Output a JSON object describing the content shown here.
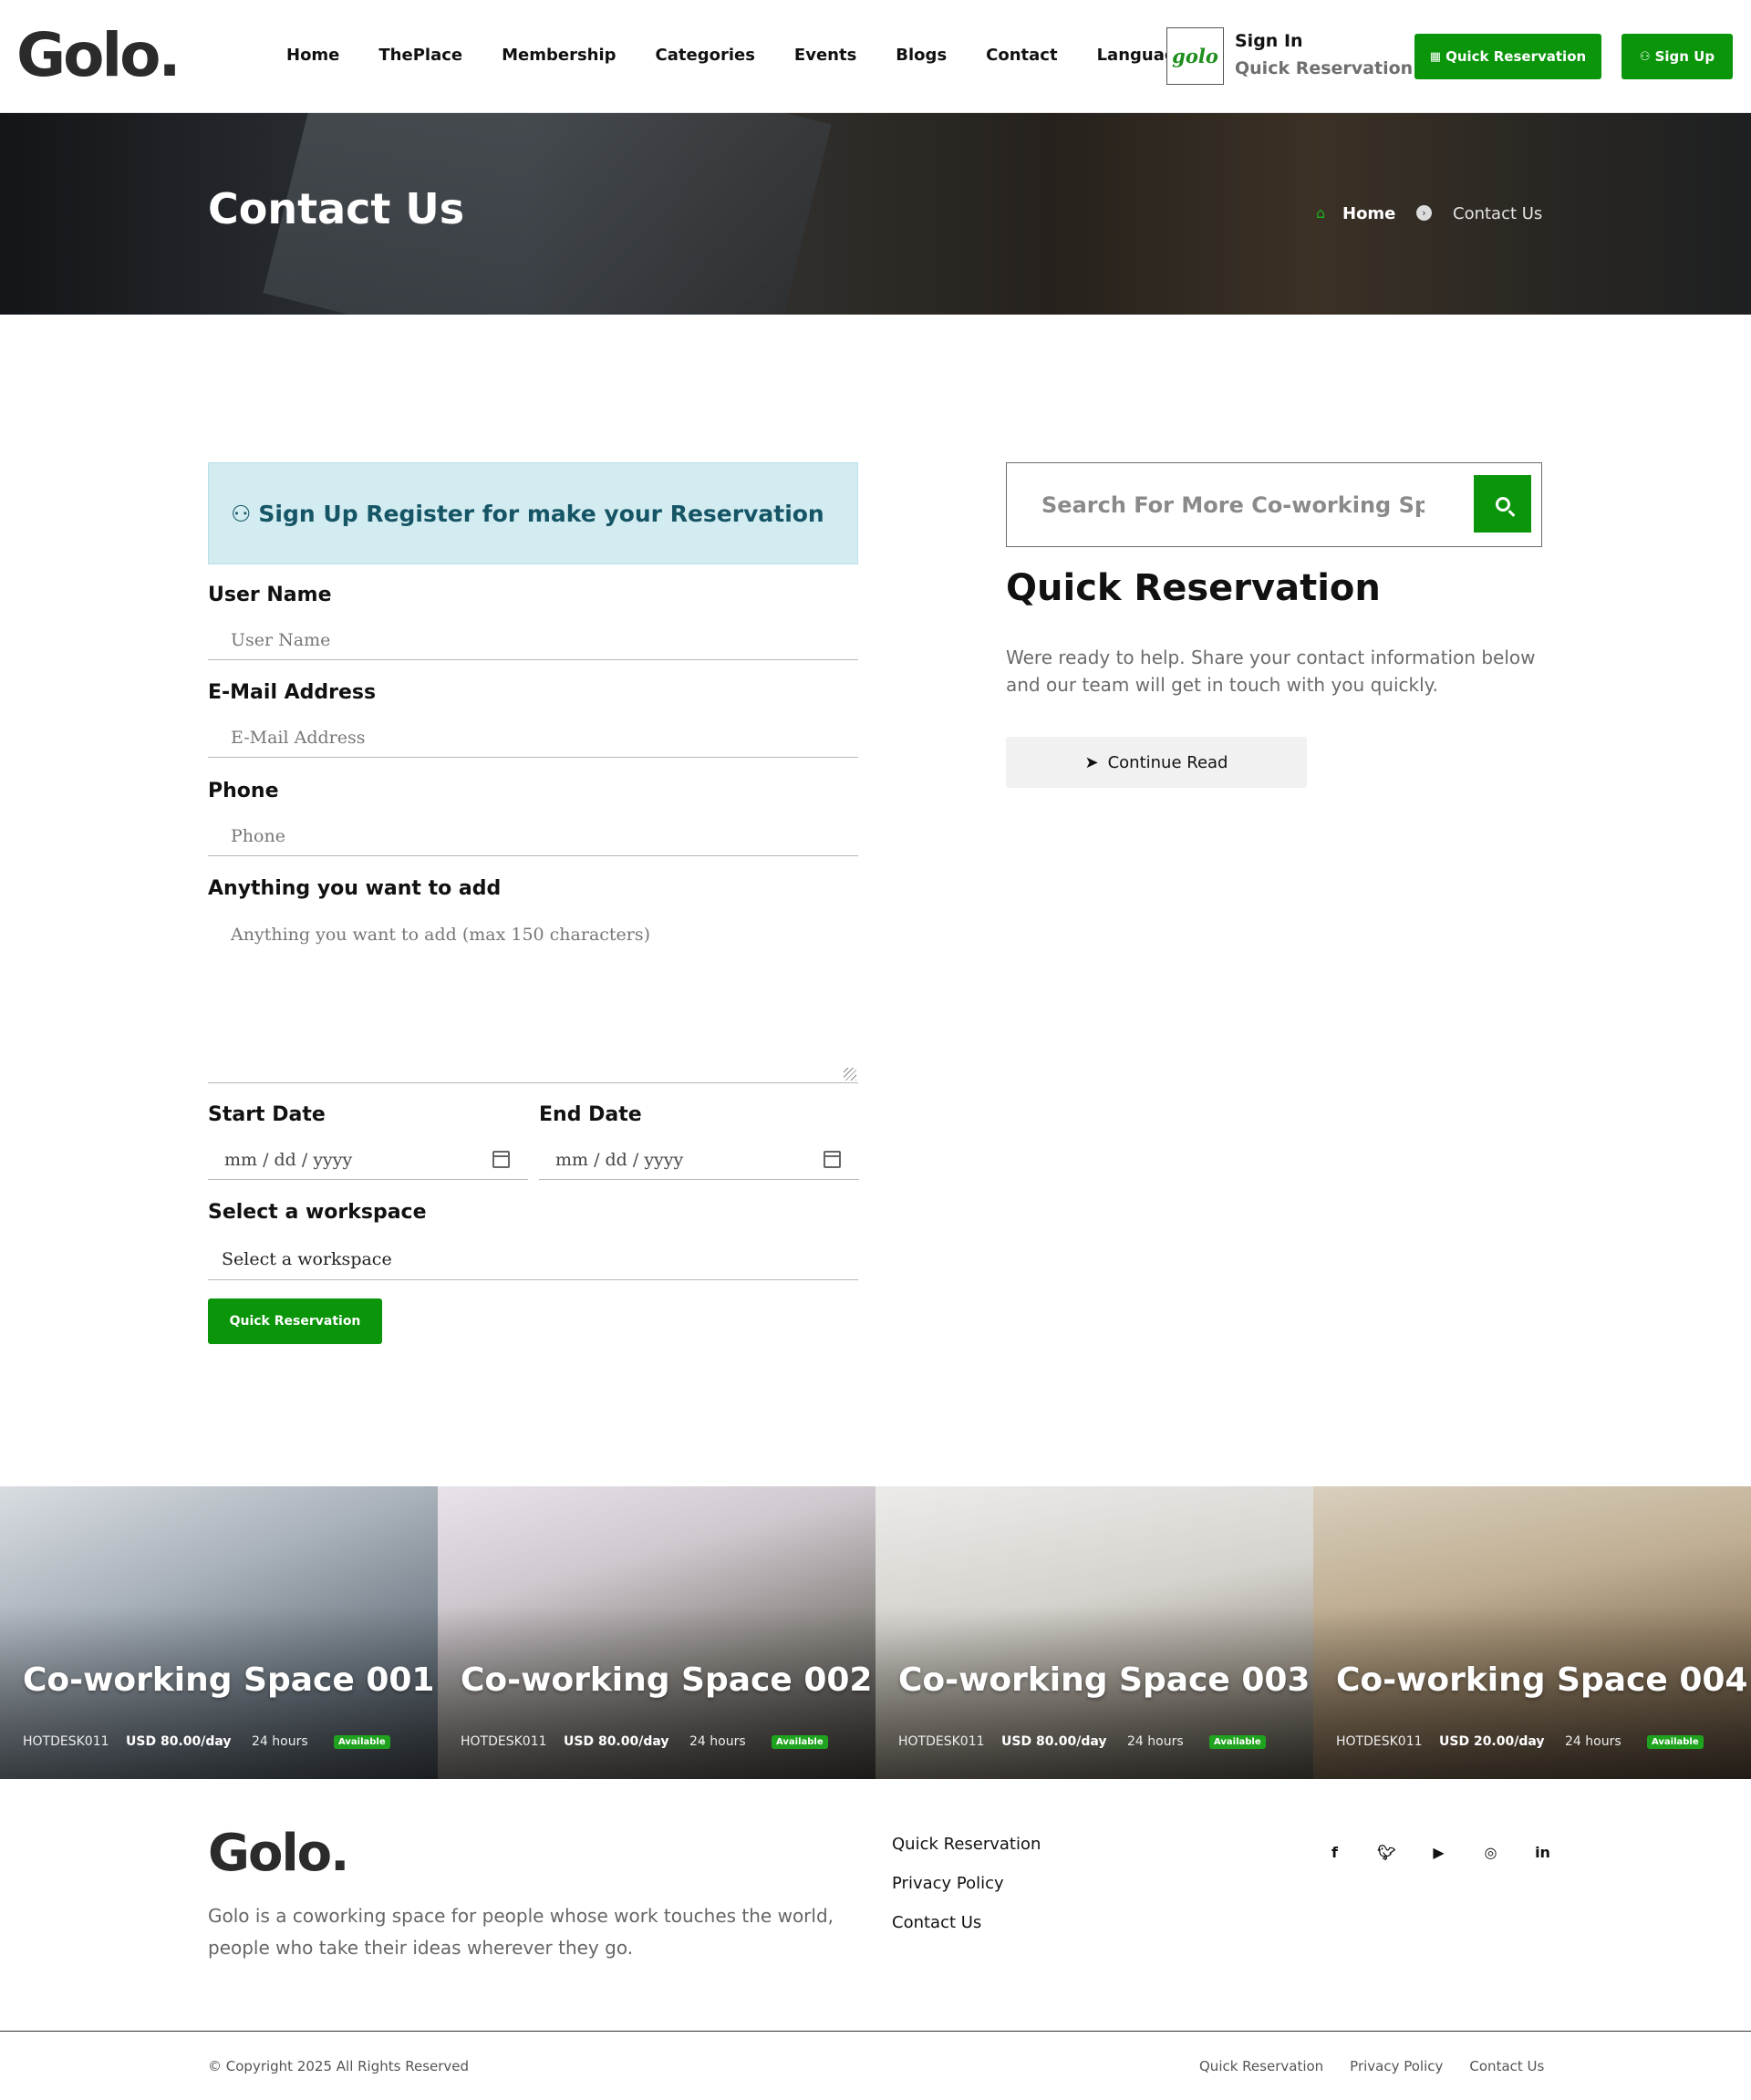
{
  "brand": {
    "logo": "Golo.",
    "mini_logo": "golo"
  },
  "nav": {
    "items": [
      "Home",
      "ThePlace",
      "Membership",
      "Categories",
      "Events",
      "Blogs",
      "Contact",
      "Language"
    ]
  },
  "header": {
    "signin": "Sign In",
    "signin_sub": "Quick Reservation",
    "quick_btn": "Quick Reservation",
    "signup_btn": "Sign Up"
  },
  "hero": {
    "title": "Contact Us",
    "breadcrumb": {
      "home": "Home",
      "current": "Contact Us"
    }
  },
  "form": {
    "notice": "Sign Up Register for make your Reservation",
    "username_label": "User Name",
    "username_placeholder": "User Name",
    "email_label": "E-Mail Address",
    "email_placeholder": "E-Mail Address",
    "phone_label": "Phone",
    "phone_placeholder": "Phone",
    "notes_label": "Anything you want to add",
    "notes_placeholder": "Anything you want to add (max 150 characters)",
    "start_label": "Start Date",
    "start_value": "mm / dd / yyyy",
    "end_label": "End Date",
    "end_value": "mm / dd / yyyy",
    "workspace_label": "Select a workspace",
    "workspace_value": "Select a workspace",
    "submit": "Quick Reservation"
  },
  "sidebar": {
    "search_placeholder": "Search For More Co-working Space",
    "title": "Quick Reservation",
    "text": "Were ready to help. Share your contact information below and our team will get in touch with you quickly.",
    "continue": "Continue Read"
  },
  "spaces": [
    {
      "title": "Co-working Space 001",
      "code": "HOTDESK011",
      "price": "USD 80.00/day",
      "hours": "24 hours",
      "status": "Available"
    },
    {
      "title": "Co-working Space 002",
      "code": "HOTDESK011",
      "price": "USD 80.00/day",
      "hours": "24 hours",
      "status": "Available"
    },
    {
      "title": "Co-working Space 003",
      "code": "HOTDESK011",
      "price": "USD 80.00/day",
      "hours": "24 hours",
      "status": "Available"
    },
    {
      "title": "Co-working Space 004",
      "code": "HOTDESK011",
      "price": "USD 20.00/day",
      "hours": "24 hours",
      "status": "Available"
    }
  ],
  "footer": {
    "logo": "Golo.",
    "description": "Golo is a coworking space for people whose work touches the world, people who take their ideas wherever they go.",
    "links": [
      "Quick Reservation",
      "Privacy Policy",
      "Contact Us"
    ],
    "socials": [
      "f",
      "t",
      "yt",
      "ig",
      "in"
    ],
    "copyright": "© Copyright 2025 All Rights Reserved",
    "bottom_links": [
      "Quick Reservation",
      "Privacy Policy",
      "Contact Us"
    ]
  },
  "colors": {
    "accent": "#0a950a",
    "notice_bg": "#d3ecf1",
    "notice_text": "#155565"
  }
}
